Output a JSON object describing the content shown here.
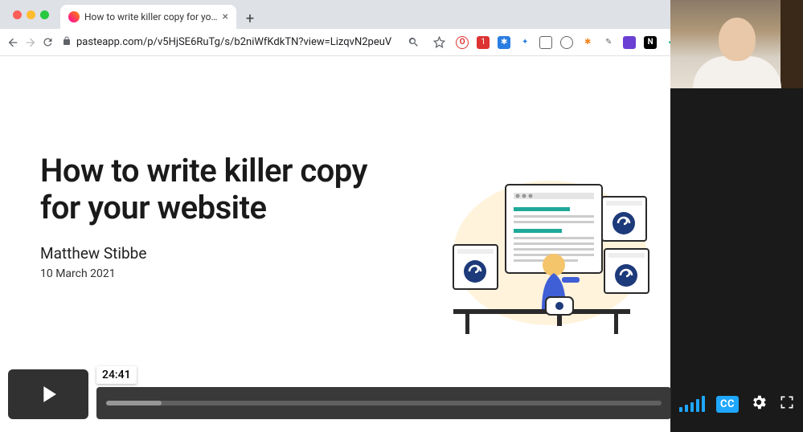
{
  "browser": {
    "tab_title": "How to write killer copy for yo…",
    "url": "pasteapp.com/p/v5HjSE6RuTg/s/b2niWfKdkTN?view=LizqvN2peuV",
    "newtab_glyph": "+",
    "close_glyph": "×"
  },
  "page": {
    "title_line1": "How to write killer copy",
    "title_line2": "for your website",
    "author": "Matthew Stibbe",
    "date": "10 March 2021"
  },
  "video": {
    "timestamp": "24:41",
    "cc_label": "CC"
  }
}
